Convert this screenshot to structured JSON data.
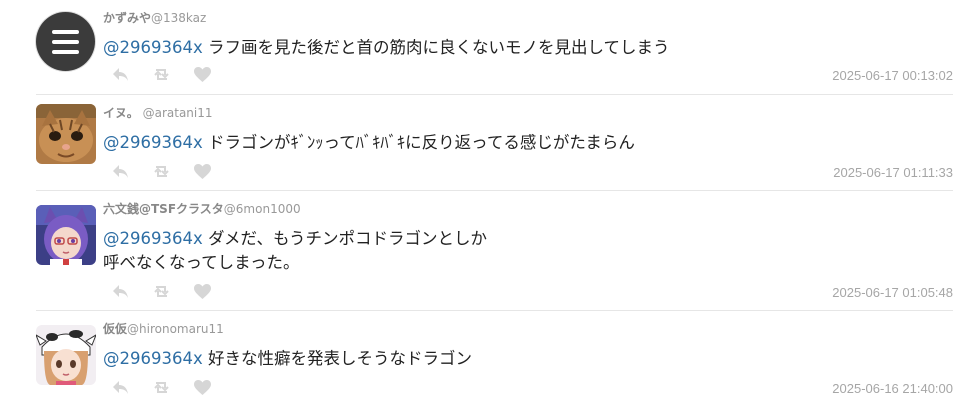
{
  "replies": [
    {
      "display_name": "かずみや",
      "handle": "@138kaz",
      "mention": "@2969364x",
      "text": "ラフ画を見た後だと首の筋肉に良くないモノを見出してしまう",
      "timestamp": "2025-06-17 00:13:02"
    },
    {
      "display_name": "イヌ。",
      "handle": "@aratani11",
      "mention": "@2969364x",
      "text": "ドラゴンがｷﾞﾝｯってﾊﾞｷﾊﾞｷに反り返ってる感じがたまらん",
      "timestamp": "2025-06-17 01:11:33"
    },
    {
      "display_name": "六文銭@TSFクラスタ",
      "handle": "@6mon1000",
      "mention": "@2969364x",
      "text": "ダメだ、もうチンポコドラゴンとしか\n呼べなくなってしまった。",
      "timestamp": "2025-06-17 01:05:48"
    },
    {
      "display_name": "仮仮",
      "handle": "@hironomaru11",
      "mention": "@2969364x",
      "text": "好きな性癖を発表しそうなドラゴン",
      "timestamp": "2025-06-16 21:40:00"
    }
  ],
  "icons": {
    "avatar_1": "menu-icon",
    "avatar_2": "cat-photo",
    "avatar_3": "anime-girl-purple",
    "avatar_4": "anime-girl-cow",
    "reply": "reply-icon",
    "retweet": "retweet-icon",
    "like": "heart-icon"
  },
  "colors": {
    "mention": "#2e6ea4",
    "muted": "#a6a6a6",
    "icon": "#d6d6d6"
  }
}
